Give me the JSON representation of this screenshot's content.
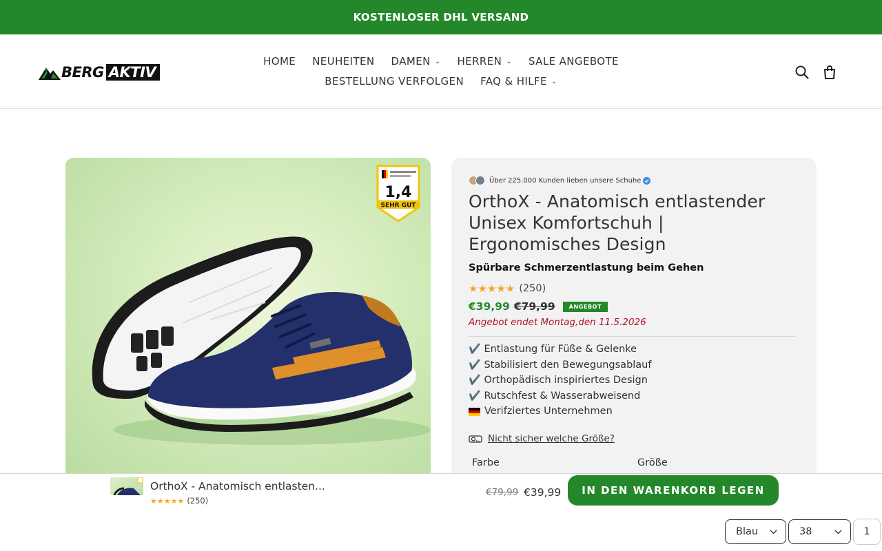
{
  "announcement": "KOSTENLOSER DHL VERSAND",
  "brand": {
    "part1": "BERG",
    "part2": "AKTIV"
  },
  "nav": {
    "row1": [
      {
        "label": "HOME",
        "dropdown": false
      },
      {
        "label": "NEUHEITEN",
        "dropdown": false
      },
      {
        "label": "DAMEN",
        "dropdown": true
      },
      {
        "label": "HERREN",
        "dropdown": true
      },
      {
        "label": "SALE ANGEBOTE",
        "dropdown": false
      }
    ],
    "row2": [
      {
        "label": "BESTELLUNG VERFOLGEN",
        "dropdown": false
      },
      {
        "label": "FAQ & HILFE",
        "dropdown": true
      }
    ]
  },
  "icons": {
    "search": "search-icon",
    "cart": "cart-icon"
  },
  "badge": {
    "score": "1,4",
    "rating_text": "SEHR GUT"
  },
  "product": {
    "social_proof": "Über 225.000 Kunden lieben unsere Schuhe",
    "title": "OrthoX - Anatomisch entlastender Unisex Komfortschuh | Ergonomisches Design",
    "subtitle": "Spürbare Schmerzentlastung beim Gehen",
    "stars": "★★★★★",
    "review_count": "(250)",
    "price_new": "€39,99",
    "price_old": "€79,99",
    "sale_badge": "ANGEBOT",
    "offer_end": "Angebot endet Montag,den 11.5.2026",
    "benefits": [
      "Entlastung für Füße & Gelenke",
      "Stabilisiert den Bewegungsablauf",
      "Orthopädisch inspiriertes Design",
      "Rutschfest & Wasserabweisend",
      "Verifziertes Unternehmen"
    ],
    "check_glyph": "✔️",
    "size_help": "Nicht sicher welche Größe?",
    "label_color": "Farbe",
    "label_size": "Größe"
  },
  "sticky": {
    "title": "OrthoX - Anatomisch entlasten...",
    "stars": "★★★★★",
    "review_count": "(250)",
    "price_old": "€79,99",
    "price_new": "€39,99",
    "add_to_cart": "IN DEN WARENKORB LEGEN",
    "color_value": "Blau",
    "size_value": "38",
    "quantity": "1"
  },
  "colors": {
    "accent": "#24882a",
    "sale_text": "#b0132c",
    "stars": "#f5a623"
  }
}
